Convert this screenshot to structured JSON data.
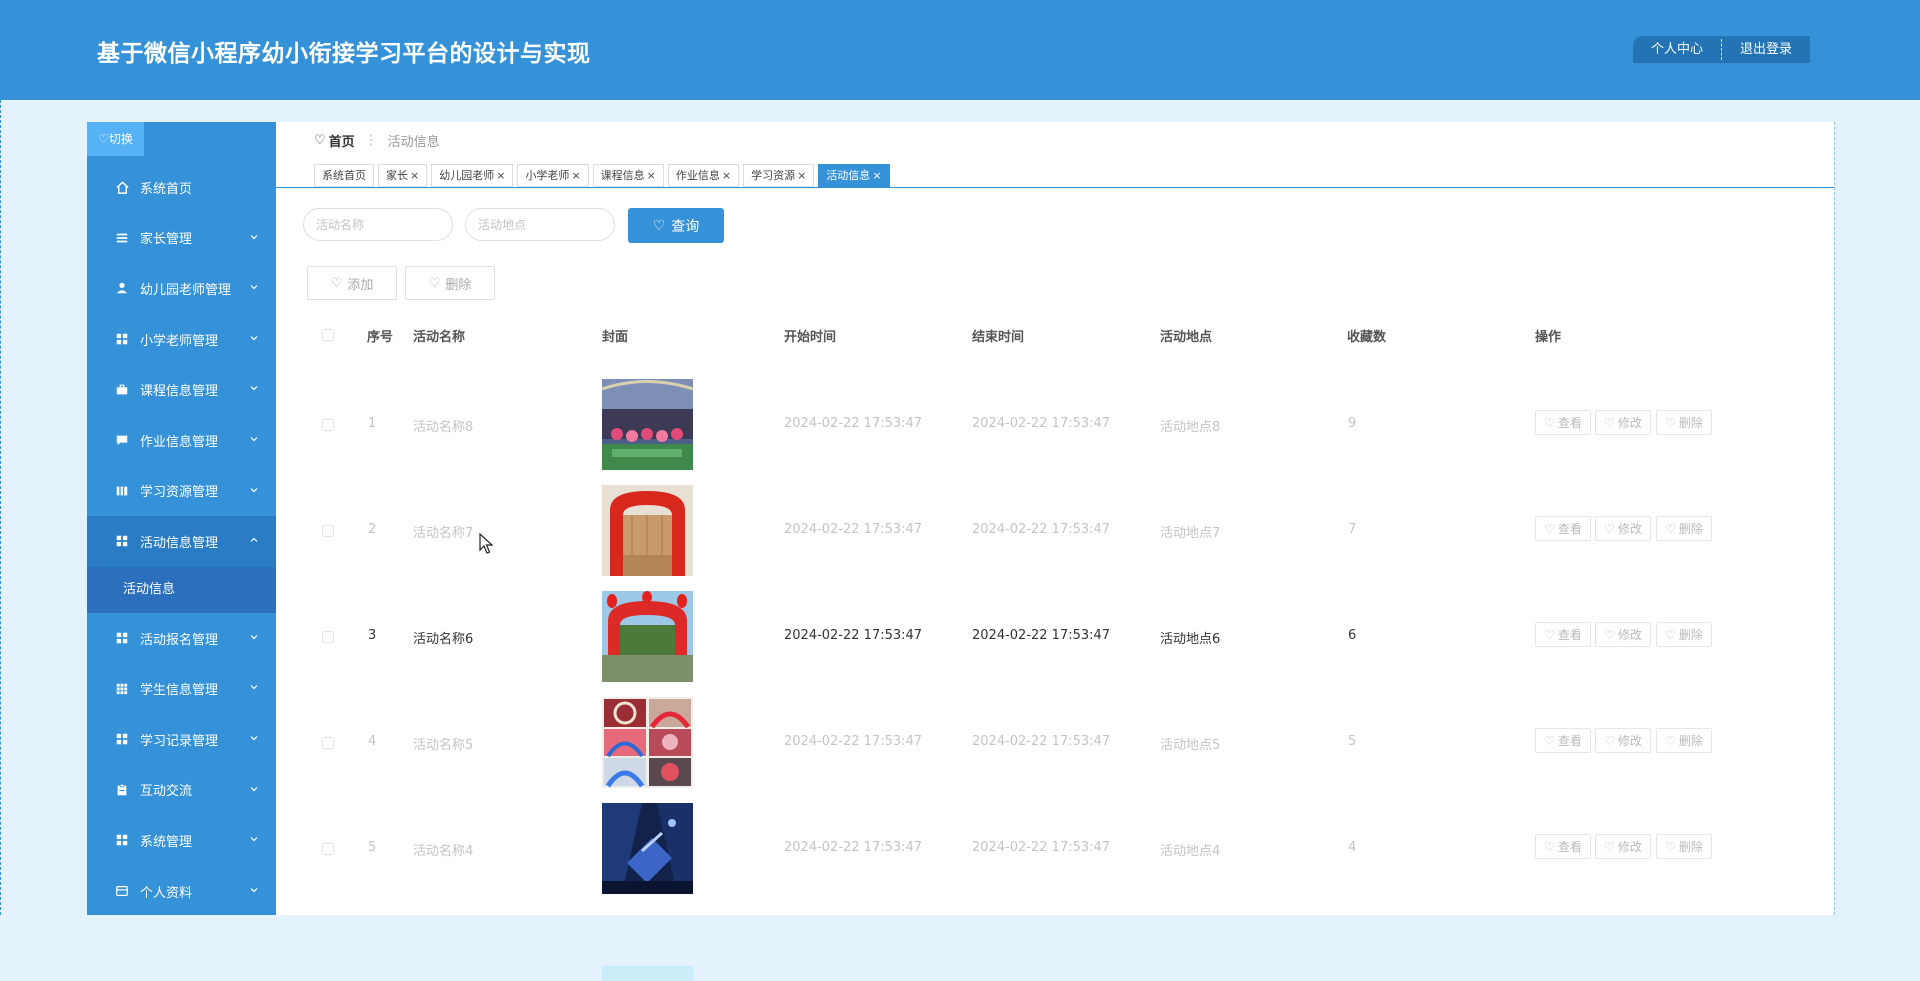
{
  "header": {
    "title": "基于微信小程序幼小衔接学习平台的设计与实现",
    "profile_label": "个人中心",
    "logout_label": "退出登录"
  },
  "sidebar": {
    "toggle_label": "切换",
    "items": [
      {
        "label": "系统首页",
        "icon": "home-icon"
      },
      {
        "label": "家长管理",
        "icon": "list-icon"
      },
      {
        "label": "幼儿园老师管理",
        "icon": "user-icon"
      },
      {
        "label": "小学老师管理",
        "icon": "grid-icon"
      },
      {
        "label": "课程信息管理",
        "icon": "briefcase-icon"
      },
      {
        "label": "作业信息管理",
        "icon": "chat-icon"
      },
      {
        "label": "学习资源管理",
        "icon": "book-icon"
      },
      {
        "label": "活动信息管理",
        "icon": "grid-icon",
        "expanded": true
      },
      {
        "label": "活动报名管理",
        "icon": "grid-icon"
      },
      {
        "label": "学生信息管理",
        "icon": "table-icon"
      },
      {
        "label": "学习记录管理",
        "icon": "grid-icon"
      },
      {
        "label": "互动交流",
        "icon": "clipboard-icon"
      },
      {
        "label": "系统管理",
        "icon": "grid-icon"
      },
      {
        "label": "个人资料",
        "icon": "card-icon"
      }
    ],
    "submenu_label": "活动信息"
  },
  "breadcrumb": {
    "home": "首页",
    "separator": "⋮",
    "current": "活动信息"
  },
  "tabs": [
    {
      "label": "系统首页",
      "closable": false
    },
    {
      "label": "家长",
      "closable": true
    },
    {
      "label": "幼儿园老师",
      "closable": true
    },
    {
      "label": "小学老师",
      "closable": true
    },
    {
      "label": "课程信息",
      "closable": true
    },
    {
      "label": "作业信息",
      "closable": true
    },
    {
      "label": "学习资源",
      "closable": true
    },
    {
      "label": "活动信息",
      "closable": true,
      "active": true
    }
  ],
  "search": {
    "name_placeholder": "活动名称",
    "location_placeholder": "活动地点",
    "query_label": "查询"
  },
  "actions": {
    "add_label": "添加",
    "delete_label": "删除"
  },
  "table": {
    "columns": [
      "序号",
      "活动名称",
      "封面",
      "开始时间",
      "结束时间",
      "活动地点",
      "收藏数",
      "操作"
    ],
    "rows": [
      {
        "index": "1",
        "name": "活动名称8",
        "cover": "stage-performance",
        "start": "2024-02-22 17:53:47",
        "end": "2024-02-22 17:53:47",
        "location": "活动地点8",
        "favorites": "9"
      },
      {
        "index": "2",
        "name": "活动名称7",
        "cover": "red-arch-wood",
        "start": "2024-02-22 17:53:47",
        "end": "2024-02-22 17:53:47",
        "location": "活动地点7",
        "favorites": "7"
      },
      {
        "index": "3",
        "name": "活动名称6",
        "cover": "red-arch-lanterns",
        "start": "2024-02-22 17:53:47",
        "end": "2024-02-22 17:53:47",
        "location": "活动地点6",
        "favorites": "6",
        "highlight": true
      },
      {
        "index": "4",
        "name": "活动名称5",
        "cover": "balloon-arches-collage",
        "start": "2024-02-22 17:53:47",
        "end": "2024-02-22 17:53:47",
        "location": "活动地点5",
        "favorites": "5"
      },
      {
        "index": "5",
        "name": "活动名称4",
        "cover": "blue-stage-room",
        "start": "2024-02-22 17:53:47",
        "end": "2024-02-22 17:53:47",
        "location": "活动地点4",
        "favorites": "4"
      }
    ],
    "row_actions": {
      "view": "查看",
      "edit": "修改",
      "delete": "删除"
    }
  },
  "colors": {
    "primary": "#3591d8",
    "sidebar_active": "#2a7cc5",
    "submenu": "#2b6fbd",
    "toggle": "#56b1f5",
    "page_bg": "#e4f2fc"
  }
}
